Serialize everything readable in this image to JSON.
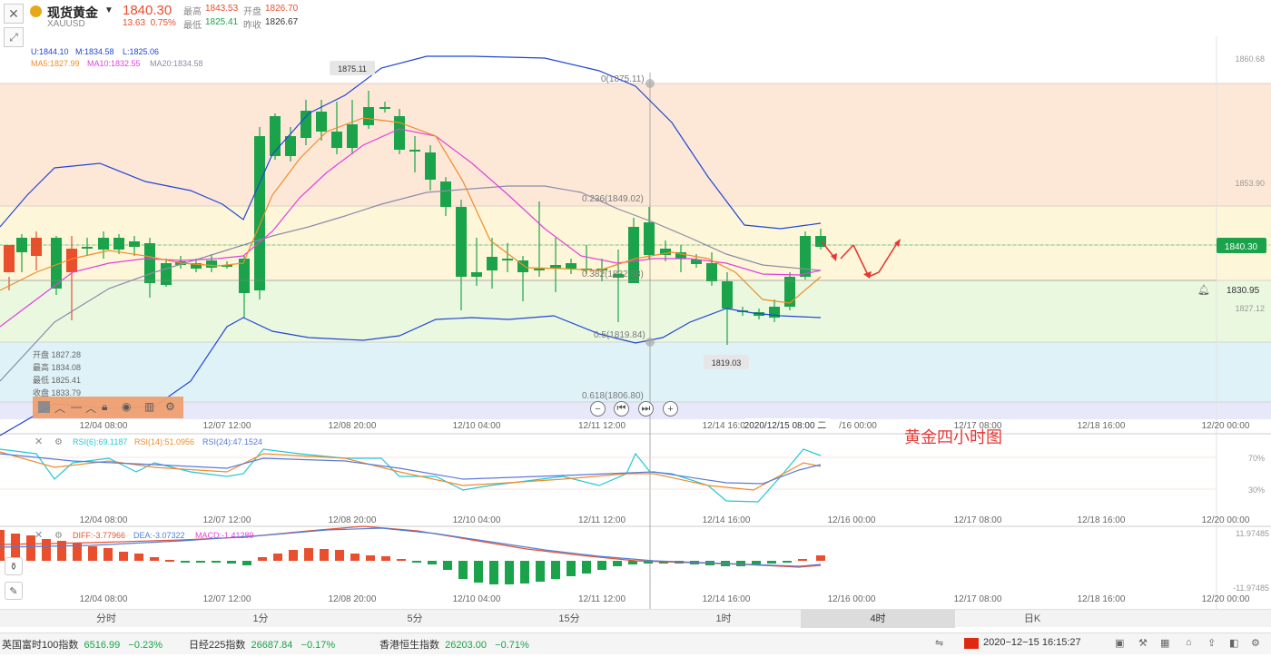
{
  "header": {
    "name": "现货黄金",
    "code": "XAUUSD",
    "price": "1840.30",
    "change": "13.63",
    "change_pct": "0.75%",
    "high_label": "最高",
    "high": "1843.53",
    "open_label": "开盘",
    "open": "1826.70",
    "low_label": "最低",
    "low": "1825.41",
    "prev_label": "昨收",
    "prev": "1826.67"
  },
  "main": {
    "boll_text": [
      "U:1844.10",
      "M:1834.58",
      "L:1825.06"
    ],
    "ma_text": [
      "MA5:1827.99",
      "MA10:1832.55",
      "MA20:1834.58"
    ],
    "price_axis": [
      "1860.68",
      "1853.90",
      "1827.12"
    ],
    "price_tag": "1840.30",
    "alert_price": "1830.95",
    "high_marker": "1875.11",
    "low_marker": "1819.03",
    "fib_levels": [
      "0(1875.11)",
      "0.236(1849.02)",
      "0.382(1832.88)",
      "0.5(1819.84)",
      "0.618(1806.80)"
    ],
    "ohlc_box": [
      "开盘 1827.28",
      "最高 1834.08",
      "最低 1825.41",
      "收盘 1833.79"
    ],
    "annotation": "黄金四小时图",
    "time_axis": [
      "12/04 08:00",
      "12/07 12:00",
      "12/08 20:00",
      "12/10 04:00",
      "12/11 12:00",
      "12/14 16:00",
      "2020/12/15 08:00 二",
      "/16 00:00",
      "12/17 08:00",
      "12/18 16:00",
      "12/20 00:00"
    ]
  },
  "rsi": {
    "labels": [
      "RSI(6):69.1187",
      "RSI(14):51.0956",
      "RSI(24):47.1524"
    ],
    "axis": [
      "70%",
      "30%"
    ],
    "time_axis": [
      "12/04 08:00",
      "12/07 12:00",
      "12/08 20:00",
      "12/10 04:00",
      "12/11 12:00",
      "12/14 16:00",
      "12/16 00:00",
      "12/17 08:00",
      "12/18 16:00",
      "12/20 00:00"
    ]
  },
  "macd": {
    "labels": [
      "DIFF:-3.77966",
      "DEA:-3.07322",
      "MACD:-1.41289"
    ],
    "axis": [
      "11.97485",
      "-11.97485"
    ],
    "time_axis": [
      "12/04 08:00",
      "12/07 12:00",
      "12/08 20:00",
      "12/10 04:00",
      "12/11 12:00",
      "12/14 16:00",
      "12/16 00:00",
      "12/17 08:00",
      "12/18 16:00",
      "12/20 00:00"
    ]
  },
  "timeframes": [
    "分时",
    "1分",
    "5分",
    "15分",
    "1时",
    "4时",
    "日K"
  ],
  "active_timeframe": "4时",
  "status": {
    "indices": [
      {
        "name": "英国富时100指数",
        "value": "6516.99",
        "pct": "−0.23%"
      },
      {
        "name": "日经225指数",
        "value": "26687.84",
        "pct": "−0.17%"
      },
      {
        "name": "香港恒生指数",
        "value": "26203.00",
        "pct": "−0.71%"
      }
    ],
    "datetime": "2020−12−15 16:15:27"
  },
  "colors": {
    "up": "#e94e2d",
    "down": "#1aa34a",
    "boll": "#2346d6",
    "ma5": "#f08c28",
    "ma10": "#e040e0",
    "ma20": "#8c8caa"
  }
}
